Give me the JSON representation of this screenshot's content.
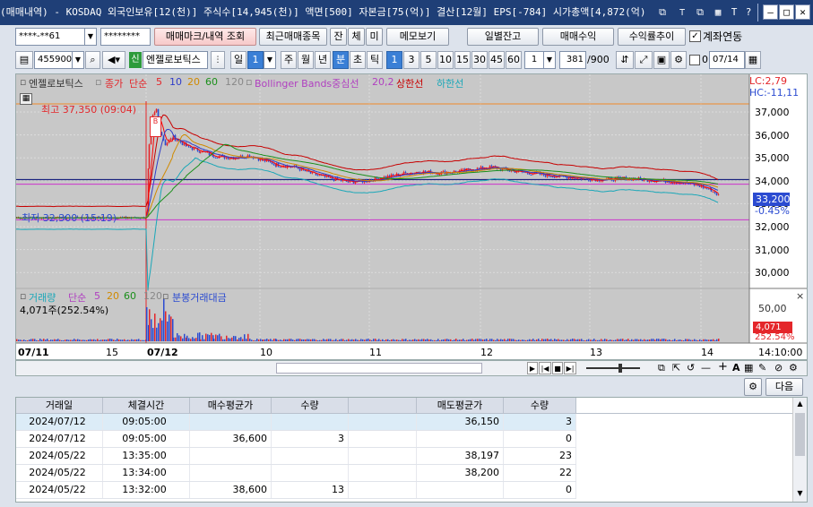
{
  "titlebar": {
    "text": "(매매내역) - KOSDAQ 외국인보유[12(천)] 주식수[14,945(천)] 액면[500] 자본금[75(억)] 결산[12월] EPS[-784] 시가총액[4,872(억)",
    "btn_t": "T",
    "btn_help": "?",
    "btn_min": "—",
    "btn_max": "□",
    "btn_close": "✕"
  },
  "toolbar1": {
    "account_masked": "****-**61",
    "password_masked": "********",
    "trade_mark_btn": "매매마크/내역 조회",
    "recent_trades_btn": "최근매매종목",
    "btn_jan": "잔",
    "btn_che": "체",
    "btn_mi": "미",
    "memo_btn": "메모보기",
    "daily_balance_btn": "일별잔고",
    "trade_profit_btn": "매매수익",
    "profit_trend_btn": "수익률추이",
    "account_link_label": "계좌연동",
    "account_link_checked": true
  },
  "toolbar2": {
    "stock_code": "455900",
    "stock_badge": "신",
    "stock_name": "엔젤로보틱스",
    "period_day": "일",
    "period_num": "1",
    "period_week": "주",
    "period_month": "월",
    "period_year": "년",
    "period_minute": "분",
    "period_second": "초",
    "period_tick": "틱",
    "intervals": [
      "1",
      "3",
      "5",
      "10",
      "15",
      "30",
      "45",
      "60"
    ],
    "custom_interval": "1",
    "count": "381",
    "count_total": "/900",
    "zero_check": "0",
    "date": "07/14"
  },
  "chart": {
    "stock_label": "엔젤로보틱스",
    "close_label": "종가",
    "ma_label": "단순",
    "ma5": "5",
    "ma10": "10",
    "ma20": "20",
    "ma60": "60",
    "ma120": "120",
    "bb_label": "Bollinger Bands중심선",
    "bb_params": "20,2",
    "bb_upper": "상한선",
    "bb_lower": "하한선",
    "lc_label": "LC:2,79",
    "hc_label": "HC:-11,11",
    "high_label": "최고 37,350 (09:04)",
    "low_label": "최저 32,300 (15:19)",
    "buy_marker": "매수",
    "buy_marker_letter": "B",
    "current_price": "33,200",
    "current_change": "-0.45%",
    "price_ticks": [
      "37,000",
      "36,000",
      "35,000",
      "34,000",
      "33,000",
      "32,000",
      "31,000",
      "30,000"
    ],
    "volume_label": "거래량",
    "vol_ma_label": "단순",
    "vol_ma5": "5",
    "vol_ma20": "20",
    "vol_ma60": "60",
    "vol_ma120": "120",
    "vol_amount_label": "분봉거래대금",
    "vol_value": "4,071주(252.54%)",
    "vol_tick": "50,00",
    "vol_current": "4,071",
    "vol_pct": "252.54%",
    "time_labels": [
      "07/11",
      "15",
      "07/12",
      "10",
      "11",
      "12",
      "13",
      "14"
    ],
    "time_right": "14:10:00",
    "colors": {
      "up": "#e4262a",
      "down": "#2b4bd1",
      "ma5": "#ff0000",
      "ma10": "#2e3cc9",
      "ma20": "#d08a00",
      "ma60": "#1a8f1a",
      "ma120": "#888888",
      "bb": "#b040c0",
      "bb_upper": "#c70000",
      "bb_lower": "#1aa7b8"
    }
  },
  "chart_bottom": {
    "btn_next": "다음"
  },
  "trade_table": {
    "headers": [
      "거래일",
      "체결시간",
      "매수평균가",
      "수량",
      "",
      "매도평균가",
      "수량"
    ],
    "rows": [
      [
        "2024/07/12",
        "09:05:00",
        "",
        "",
        "",
        "36,150",
        "3"
      ],
      [
        "2024/07/12",
        "09:05:00",
        "36,600",
        "3",
        "",
        "",
        "0"
      ],
      [
        "2024/05/22",
        "13:35:00",
        "",
        "",
        "",
        "38,197",
        "23"
      ],
      [
        "2024/05/22",
        "13:34:00",
        "",
        "",
        "",
        "38,200",
        "22"
      ],
      [
        "2024/05/22",
        "13:32:00",
        "38,600",
        "13",
        "",
        "",
        "0"
      ]
    ]
  }
}
